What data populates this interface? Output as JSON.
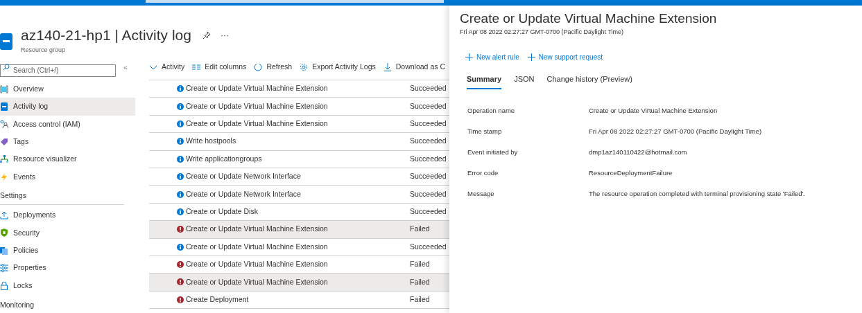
{
  "header": {
    "title": "az140-21-hp1 | Activity log",
    "subtitle": "Resource group",
    "more": "···"
  },
  "sidebar": {
    "search": {
      "placeholder": "Search (Ctrl+/)"
    },
    "collapse": "«",
    "items": [
      {
        "kind": "link",
        "label": "Overview",
        "selected": false
      },
      {
        "kind": "link",
        "label": "Activity log",
        "selected": true
      },
      {
        "kind": "link",
        "label": "Access control (IAM)",
        "selected": false
      },
      {
        "kind": "link",
        "label": "Tags",
        "selected": false
      },
      {
        "kind": "link",
        "label": "Resource visualizer",
        "selected": false
      },
      {
        "kind": "link",
        "label": "Events",
        "selected": false
      },
      {
        "kind": "header",
        "label": "Settings"
      },
      {
        "kind": "link",
        "label": "Deployments",
        "selected": false
      },
      {
        "kind": "link",
        "label": "Security",
        "selected": false
      },
      {
        "kind": "link",
        "label": "Policies",
        "selected": false
      },
      {
        "kind": "link",
        "label": "Properties",
        "selected": false
      },
      {
        "kind": "link",
        "label": "Locks",
        "selected": false
      },
      {
        "kind": "header",
        "label": "Monitoring"
      }
    ]
  },
  "toolbar": [
    "Activity",
    "Edit columns",
    "Refresh",
    "Export Activity Logs",
    "Download as C"
  ],
  "table": {
    "rows": [
      {
        "kind": "info",
        "operation": "Create or Update Virtual Machine Extension",
        "status": "Succeeded",
        "selected": false
      },
      {
        "kind": "info",
        "operation": "Create or Update Virtual Machine Extension",
        "status": "Succeeded",
        "selected": false
      },
      {
        "kind": "info",
        "operation": "Create or Update Virtual Machine Extension",
        "status": "Succeeded",
        "selected": false
      },
      {
        "kind": "info",
        "operation": "Write hostpools",
        "status": "Succeeded",
        "selected": false
      },
      {
        "kind": "info",
        "operation": "Write applicationgroups",
        "status": "Succeeded",
        "selected": false
      },
      {
        "kind": "info",
        "operation": "Create or Update Network Interface",
        "status": "Succeeded",
        "selected": false
      },
      {
        "kind": "info",
        "operation": "Create or Update Network Interface",
        "status": "Succeeded",
        "selected": false
      },
      {
        "kind": "info",
        "operation": "Create or Update Disk",
        "status": "Succeeded",
        "selected": false
      },
      {
        "kind": "error",
        "operation": "Create or Update Virtual Machine Extension",
        "status": "Failed",
        "selected": true
      },
      {
        "kind": "info",
        "operation": "Create or Update Virtual Machine Extension",
        "status": "Succeeded",
        "selected": false
      },
      {
        "kind": "error",
        "operation": "Create or Update Virtual Machine Extension",
        "status": "Failed",
        "selected": false
      },
      {
        "kind": "error",
        "operation": "Create or Update Virtual Machine Extension",
        "status": "Failed",
        "selected": true
      },
      {
        "kind": "error",
        "operation": "Create Deployment",
        "status": "Failed",
        "selected": false
      }
    ]
  },
  "panel": {
    "title": "Create or Update Virtual Machine Extension",
    "subtitle": "Fri Apr 08 2022 02:27:27 GMT-0700 (Pacific Daylight Time)",
    "actions": [
      "New alert rule",
      "New support request"
    ],
    "tabs": [
      {
        "label": "Summary",
        "selected": true
      },
      {
        "label": "JSON",
        "selected": false
      },
      {
        "label": "Change history (Preview)",
        "selected": false
      }
    ],
    "details": [
      {
        "label": "Operation name",
        "value": "Create or Update Virtual Machine Extension"
      },
      {
        "label": "Time stamp",
        "value": "Fri Apr 08 2022 02:27:27 GMT-0700 (Pacific Daylight Time)"
      },
      {
        "label": "Event initiated by",
        "value": "dmp1az140110422@hotmail.com"
      },
      {
        "label": "Error code",
        "value": "ResourceDeploymentFailure"
      },
      {
        "label": "Message",
        "value": "The resource operation completed with terminal provisioning state 'Failed'."
      }
    ]
  }
}
